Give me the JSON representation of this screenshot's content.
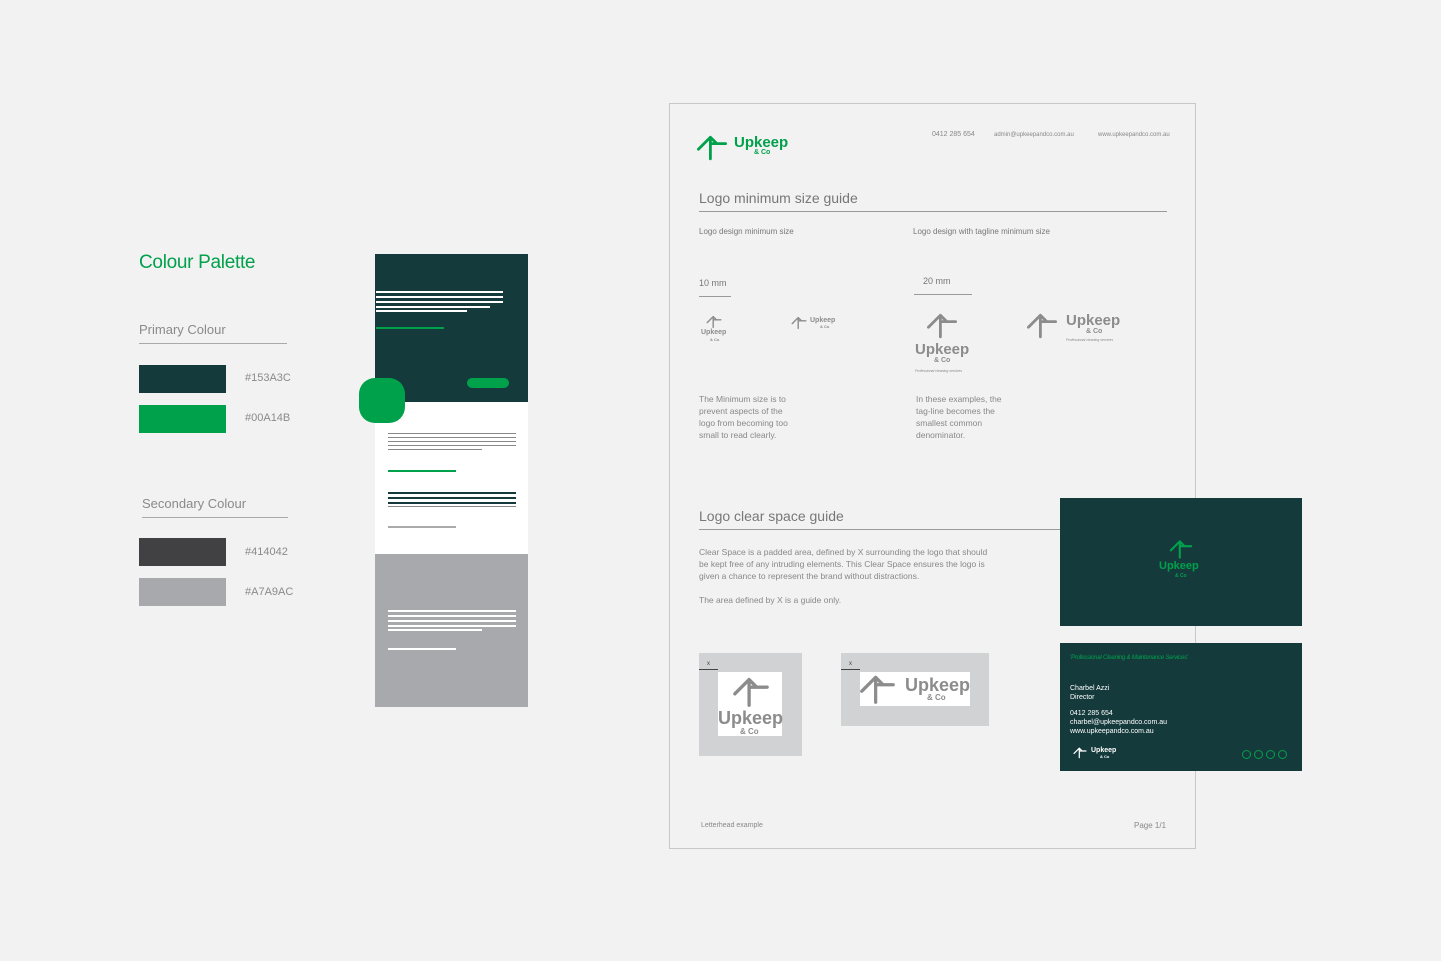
{
  "palette": {
    "title": "Colour Palette",
    "primary_label": "Primary Colour",
    "secondary_label": "Secondary Colour",
    "primary": [
      {
        "hex": "#153A3C",
        "color": "#153a3c"
      },
      {
        "hex": "#00A14B",
        "color": "#00a14b"
      }
    ],
    "secondary": [
      {
        "hex": "#414042",
        "color": "#414042"
      },
      {
        "hex": "#A7A9AC",
        "color": "#a7a9ac"
      }
    ]
  },
  "letterhead": {
    "brand": {
      "name": "Upkeep",
      "sub": "& Co"
    },
    "contact": {
      "phone": "0412 285 654",
      "email": "admin@upkeepandco.com.au",
      "web": "www.upkeepandco.com.au"
    },
    "min_size": {
      "title": "Logo minimum size guide",
      "col1_label": "Logo design minimum size",
      "col2_label": "Logo design with tagline minimum size",
      "col1_measure": "10 mm",
      "col2_measure": "20 mm",
      "tagline": "Professional cleaning services",
      "col1_text": [
        "The Minimum size is to",
        "prevent aspects of the",
        "logo from becoming too",
        "small to read clearly."
      ],
      "col2_text": [
        "In these examples, the",
        "tag-line becomes the",
        "smallest common",
        "denominator."
      ]
    },
    "clear_space": {
      "title": "Logo clear space guide",
      "text": [
        "Clear Space is a padded area, defined by X surrounding the logo that should",
        "be kept free of any intruding elements. This Clear Space ensures the logo is",
        "given a chance to represent the brand without distractions."
      ],
      "note": "The area defined by X is a guide only.",
      "x_marker": "x"
    },
    "footer_left": "Letterhead example",
    "footer_right": "Page 1/1"
  },
  "card_back": {
    "tagline": "'Professional Cleaning & Maintenance Services'",
    "name": "Charbel Azzi",
    "role": "Director",
    "phone": "0412 285 654",
    "email": "charbel@upkeepandco.com.au",
    "web": "www.upkeepandco.com.au",
    "social_icons": [
      "globe-icon",
      "facebook-icon",
      "instagram-icon",
      "linkedin-icon"
    ]
  },
  "colors": {
    "dark": "#153a3c",
    "green": "#00a14b",
    "grey": "#a7a9ac",
    "charcoal": "#414042"
  }
}
